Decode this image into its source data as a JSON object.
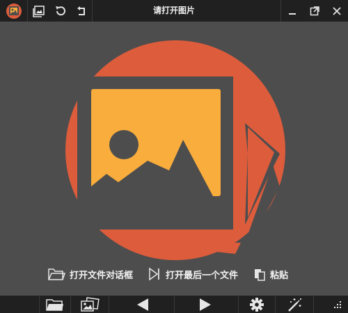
{
  "window": {
    "title": "请打开图片"
  },
  "titlebar": {
    "buttons": [
      "app-logo-icon",
      "gallery-icon",
      "rotate-left-icon",
      "back-icon"
    ],
    "window_controls": [
      "minimize-icon",
      "maximize-icon",
      "close-icon"
    ]
  },
  "quick_actions": {
    "open_dialog": "打开文件对话框",
    "open_last": "打开最后一个文件",
    "paste": "粘贴"
  },
  "bottombar": {
    "buttons": [
      "folder-icon",
      "gallery-icon",
      "previous-icon",
      "next-icon",
      "settings-icon",
      "magic-wand-icon",
      "menu-grid-icon"
    ]
  },
  "colors": {
    "accent": "#dd5c3c",
    "photo_fill": "#f9ad3c",
    "frame": "#4d4d4d",
    "background": "#4d4d4d",
    "bar": "#202020"
  }
}
